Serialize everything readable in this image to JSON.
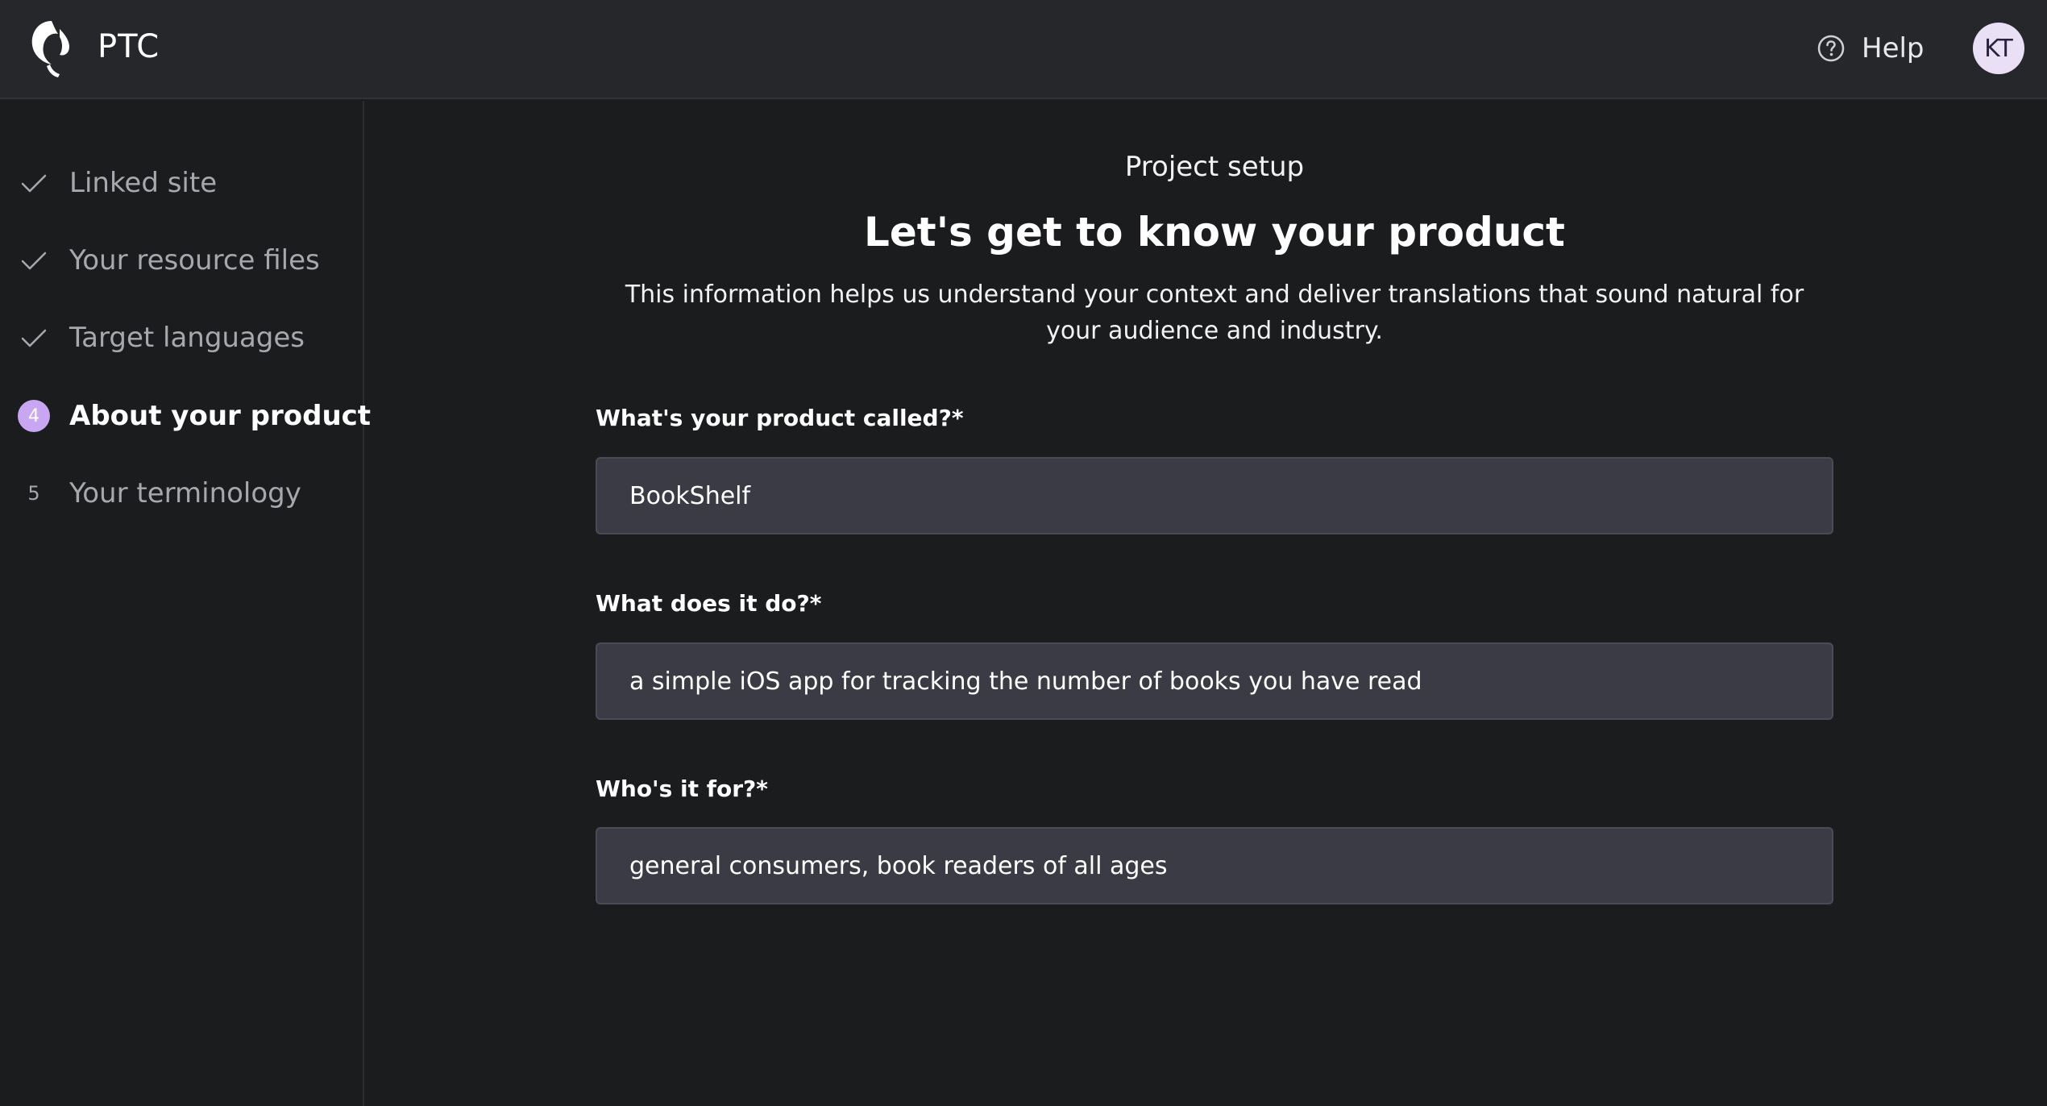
{
  "app": {
    "brand": "PTC",
    "logo_icon": "ptc-logo-icon"
  },
  "header": {
    "help_label": "Help",
    "help_icon": "question-circle-icon",
    "avatar_initials": "KT"
  },
  "sidebar": {
    "steps": [
      {
        "marker": "✓",
        "label": "Linked site",
        "state": "complete"
      },
      {
        "marker": "✓",
        "label": "Your resource files",
        "state": "complete"
      },
      {
        "marker": "✓",
        "label": "Target languages",
        "state": "complete"
      },
      {
        "marker": "4",
        "label": "About your product",
        "state": "active"
      },
      {
        "marker": "5",
        "label": "Your terminology",
        "state": "upcoming"
      }
    ]
  },
  "main": {
    "eyebrow": "Project setup",
    "heading": "Let's get to know your product",
    "intro": "This information helps us understand your context and deliver translations that sound natural for your audience and industry.",
    "fields": [
      {
        "label": "What's your product called?*",
        "value": "BookShelf"
      },
      {
        "label": "What does it do?*",
        "value": "a simple iOS app for tracking the number of books you have read"
      },
      {
        "label": "Who's it for?*",
        "value": "general consumers, book readers of all ages"
      }
    ]
  },
  "colors": {
    "background": "#1a1c1e",
    "topbar": "#25272b",
    "input_bg": "#3a3b44",
    "accent": "#c8a6f2",
    "avatar_bg": "#e9e0f6"
  }
}
